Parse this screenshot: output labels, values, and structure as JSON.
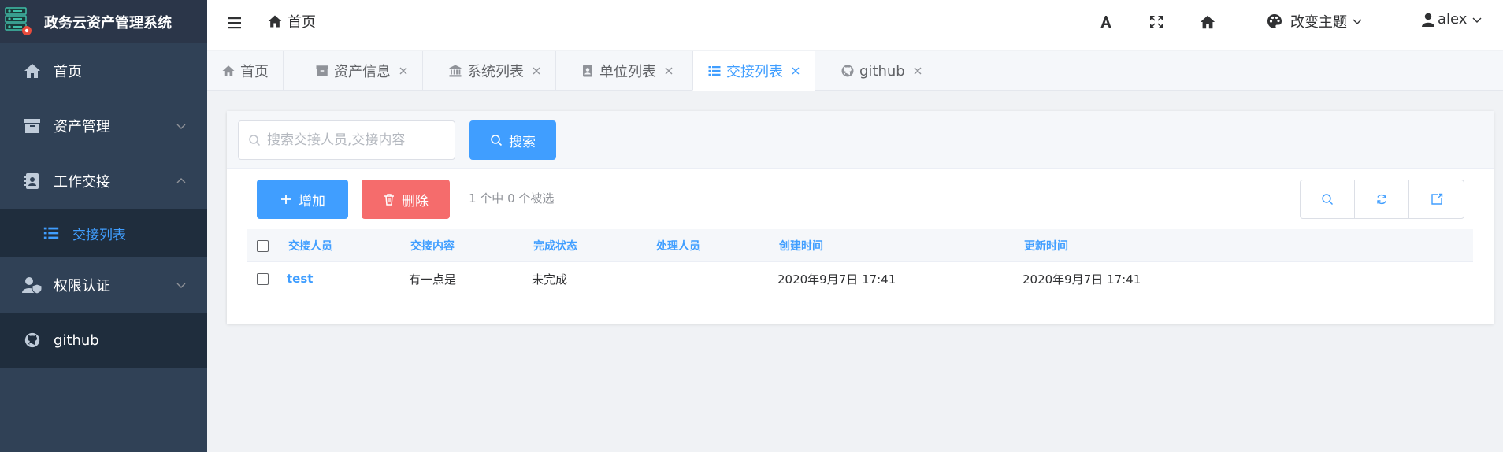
{
  "app": {
    "title": "政务云资产管理系统"
  },
  "sidebar": {
    "items": [
      {
        "label": "首页",
        "icon": "home-icon"
      },
      {
        "label": "资产管理",
        "icon": "archive-icon",
        "arrow": "down"
      },
      {
        "label": "工作交接",
        "icon": "contact-card-icon",
        "arrow": "up"
      },
      {
        "label": "交接列表",
        "icon": "list-icon",
        "sub": true,
        "active": true
      },
      {
        "label": "权限认证",
        "icon": "user-shield-icon",
        "arrow": "down"
      },
      {
        "label": "github",
        "icon": "github-icon"
      }
    ]
  },
  "navbar": {
    "breadcrumb": "首页",
    "theme_label": "改变主题",
    "user_name": "alex"
  },
  "tabs": [
    {
      "label": "首页",
      "icon": "home-icon",
      "closable": false
    },
    {
      "label": "资产信息",
      "icon": "archive-icon",
      "closable": true
    },
    {
      "label": "系统列表",
      "icon": "bank-icon",
      "closable": true
    },
    {
      "label": "单位列表",
      "icon": "address-book-icon",
      "closable": true
    },
    {
      "label": "交接列表",
      "icon": "list-icon",
      "closable": true,
      "active": true
    },
    {
      "label": "github",
      "icon": "github-icon",
      "closable": true
    }
  ],
  "search": {
    "placeholder": "搜索交接人员,交接内容",
    "button_label": "搜索"
  },
  "toolbar": {
    "add_label": "增加",
    "delete_label": "删除",
    "selection_text": "1 个中 0 个被选"
  },
  "table": {
    "columns": [
      "交接人员",
      "交接内容",
      "完成状态",
      "处理人员",
      "创建时间",
      "更新时间"
    ],
    "rows": [
      [
        "test",
        "有一点是",
        "未完成",
        "",
        "2020年9月7日 17:41",
        "2020年9月7日 17:41"
      ]
    ]
  },
  "colors": {
    "sidebar_bg": "#304156",
    "accent": "#409eff",
    "danger": "#f56c6c"
  }
}
